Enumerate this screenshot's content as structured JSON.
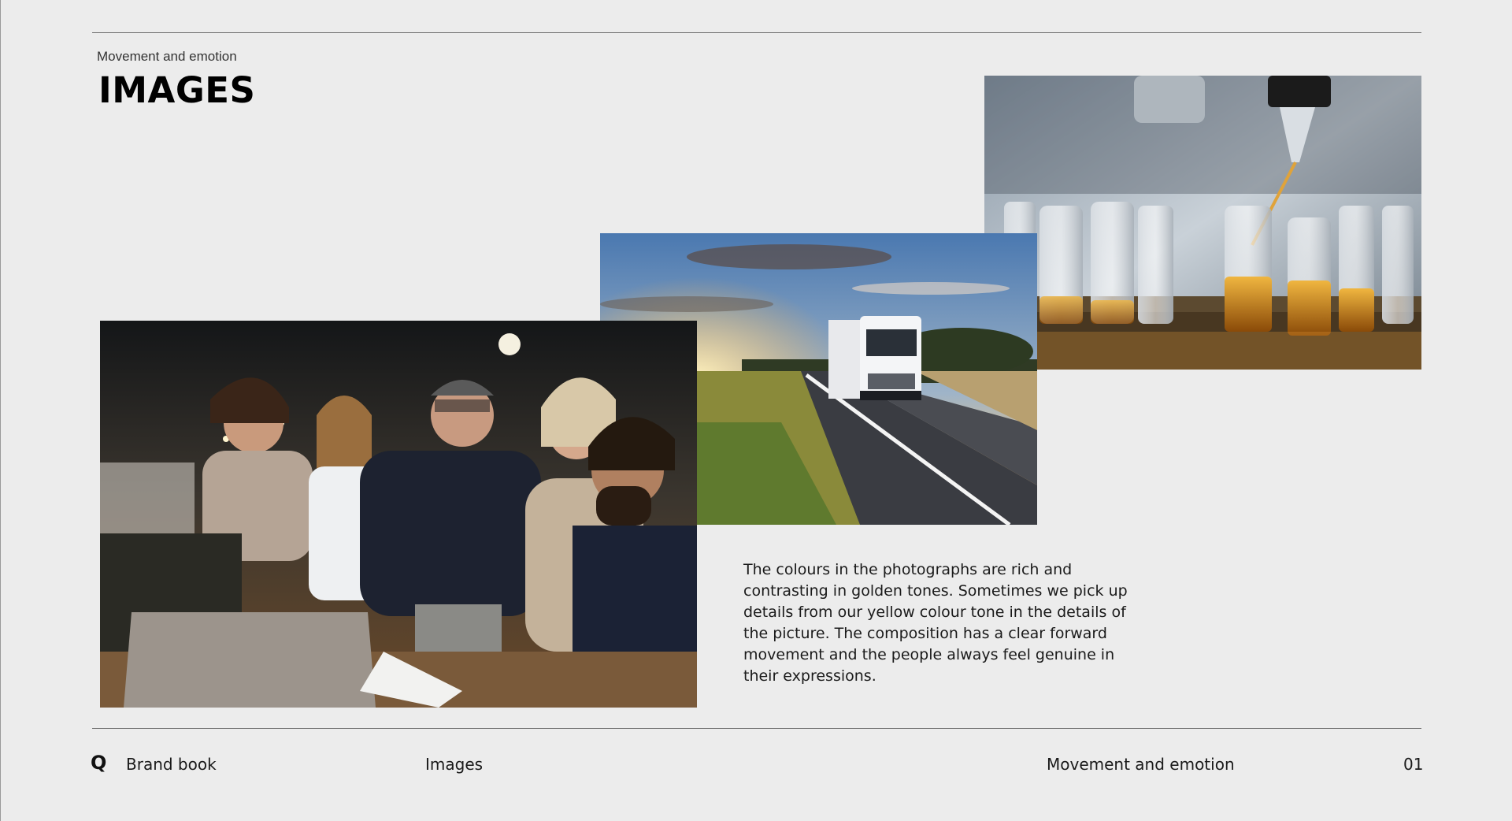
{
  "header": {
    "eyebrow": "Movement and emotion",
    "title": "IMAGES"
  },
  "images": [
    {
      "name": "laboratory-test-tubes-photo",
      "subject": "pipette dropping golden liquid into row of glass test tubes"
    },
    {
      "name": "truck-on-highway-photo",
      "subject": "white truck driving on a road at sunset"
    },
    {
      "name": "team-meeting-photo",
      "subject": "group of colleagues gathered around a laptop in an office"
    }
  ],
  "body": {
    "text": "The colours in the photographs are rich and contrasting in golden tones. Sometimes we pick up details from our yellow colour tone in the details of the picture. The composition has a clear forward movement and the people always feel genuine in their expressions."
  },
  "footer": {
    "logo": "Q",
    "brand": "Brand book",
    "section": "Images",
    "topic": "Movement and emotion",
    "page_number": "01"
  },
  "colors": {
    "background": "#ececec",
    "rule": "#6f6f6f",
    "text": "#111111"
  }
}
